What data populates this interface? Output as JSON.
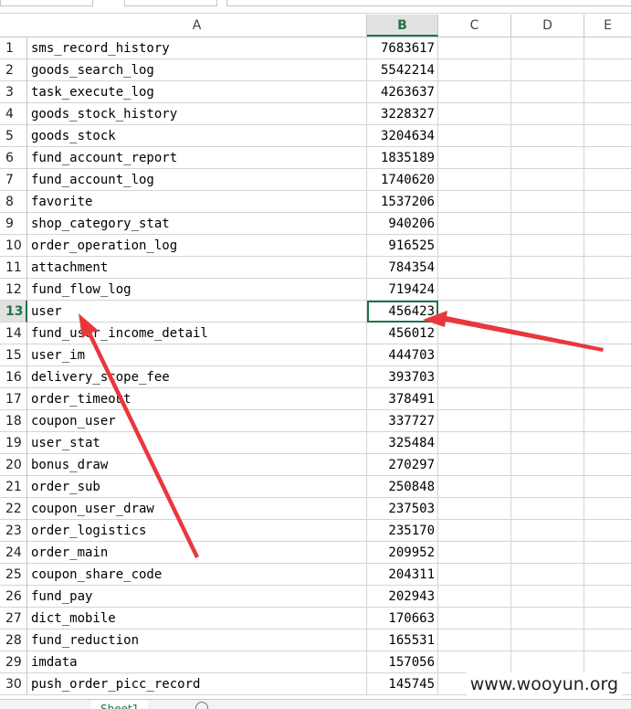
{
  "spreadsheet": {
    "columns": [
      "A",
      "B",
      "C",
      "D",
      "E"
    ],
    "selected_column": "B",
    "selected_row": "13",
    "rows": [
      {
        "num": "1",
        "a": "sms_record_history",
        "b": "7683617"
      },
      {
        "num": "2",
        "a": "goods_search_log",
        "b": "5542214"
      },
      {
        "num": "3",
        "a": "task_execute_log",
        "b": "4263637"
      },
      {
        "num": "4",
        "a": "goods_stock_history",
        "b": "3228327"
      },
      {
        "num": "5",
        "a": "goods_stock",
        "b": "3204634"
      },
      {
        "num": "6",
        "a": "fund_account_report",
        "b": "1835189"
      },
      {
        "num": "7",
        "a": "fund_account_log",
        "b": "1740620"
      },
      {
        "num": "8",
        "a": "favorite",
        "b": "1537206"
      },
      {
        "num": "9",
        "a": "shop_category_stat",
        "b": "940206"
      },
      {
        "num": "10",
        "a": "order_operation_log",
        "b": "916525"
      },
      {
        "num": "11",
        "a": "attachment",
        "b": "784354"
      },
      {
        "num": "12",
        "a": "fund_flow_log",
        "b": "719424"
      },
      {
        "num": "13",
        "a": "user",
        "b": "456423"
      },
      {
        "num": "14",
        "a": "fund_user_income_detail",
        "b": "456012"
      },
      {
        "num": "15",
        "a": "user_im",
        "b": "444703"
      },
      {
        "num": "16",
        "a": "delivery_scope_fee",
        "b": "393703"
      },
      {
        "num": "17",
        "a": "order_timeout",
        "b": "378491"
      },
      {
        "num": "18",
        "a": "coupon_user",
        "b": "337727"
      },
      {
        "num": "19",
        "a": "user_stat",
        "b": "325484"
      },
      {
        "num": "20",
        "a": "bonus_draw",
        "b": "270297"
      },
      {
        "num": "21",
        "a": "order_sub",
        "b": "250848"
      },
      {
        "num": "22",
        "a": "coupon_user_draw",
        "b": "237503"
      },
      {
        "num": "23",
        "a": "order_logistics",
        "b": "235170"
      },
      {
        "num": "24",
        "a": "order_main",
        "b": "209952"
      },
      {
        "num": "25",
        "a": "coupon_share_code",
        "b": "204311"
      },
      {
        "num": "26",
        "a": "fund_pay",
        "b": "202943"
      },
      {
        "num": "27",
        "a": "dict_mobile",
        "b": "170663"
      },
      {
        "num": "28",
        "a": "fund_reduction",
        "b": "165531"
      },
      {
        "num": "29",
        "a": "imdata",
        "b": "157056"
      },
      {
        "num": "30",
        "a": "push_order_picc_record",
        "b": "145745"
      }
    ]
  },
  "sheet_tabs": {
    "active": "Sheet1"
  },
  "watermark": {
    "text": "www.wooyun.org"
  },
  "colors": {
    "excel_green": "#217346",
    "annotation_red": "#e8383d",
    "gridline": "#d4d4d4"
  }
}
